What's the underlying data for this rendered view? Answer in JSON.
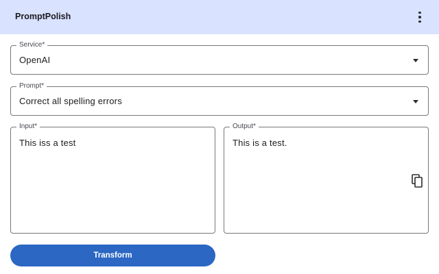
{
  "app": {
    "title": "PromptPolish"
  },
  "form": {
    "service": {
      "label": "Service*",
      "value": "OpenAI"
    },
    "prompt": {
      "label": "Prompt*",
      "value": "Correct all spelling errors"
    },
    "input": {
      "label": "Input*",
      "value": "This iss a test"
    },
    "output": {
      "label": "Output*",
      "value": "This is a test."
    }
  },
  "actions": {
    "transform_label": "Transform"
  },
  "icons": {
    "menu": "more-vert-icon",
    "copy": "copy-icon",
    "dropdown": "dropdown-arrow-icon"
  },
  "colors": {
    "topbar": "#d9e2ff",
    "primary_button": "#2b67c3",
    "outline": "#77767a"
  }
}
